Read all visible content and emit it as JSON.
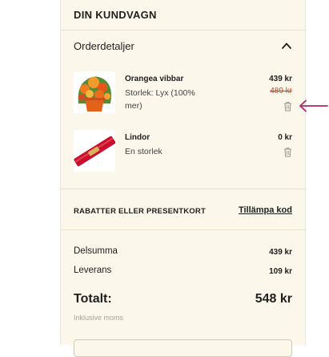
{
  "cart": {
    "title": "DIN KUNDVAGN",
    "order_details_label": "Orderdetaljer",
    "items": [
      {
        "name": "Orangea vibbar",
        "variant": "Storlek: Lyx (100% mer)",
        "price": "439 kr",
        "old_price": "489 kr",
        "image_icon": "orange-flower-bouquet"
      },
      {
        "name": "Lindor",
        "variant": "En storlek",
        "price": "0 kr",
        "image_icon": "red-chocolate-bar"
      }
    ],
    "discount_label": "RABATTER ELLER PRESENTKORT",
    "discount_link": "Tillämpa kod",
    "subtotal_label": "Delsumma",
    "subtotal_value": "439 kr",
    "delivery_label": "Leverans",
    "delivery_value": "109 kr",
    "total_label": "Totalt:",
    "total_value": "548 kr",
    "vat_note": "Inklusive moms"
  },
  "colors": {
    "panel_background": "#fbf7ea",
    "old_price": "#c84a2a",
    "annotation_arrow": "#b0286a"
  }
}
